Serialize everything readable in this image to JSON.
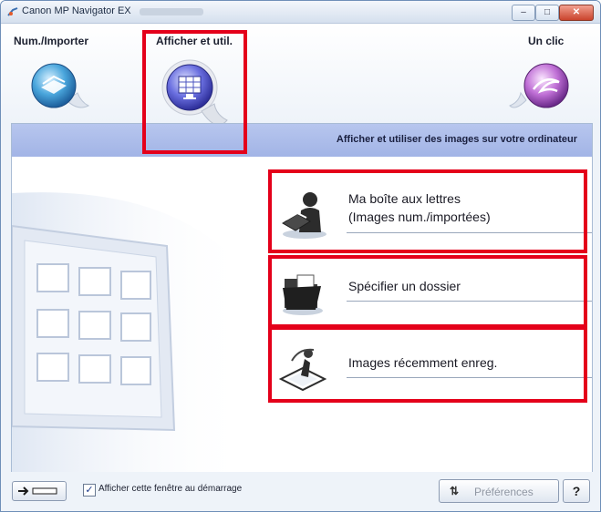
{
  "window": {
    "title": "Canon MP Navigator EX"
  },
  "modes": {
    "scan_import": {
      "label": "Num./Importer",
      "icon": "scanner-icon"
    },
    "view_use": {
      "label": "Afficher et util.",
      "icon": "monitor-grid-icon"
    },
    "one_click": {
      "label": "Un clic",
      "icon": "swirl-icon"
    }
  },
  "panel": {
    "header": "Afficher et utiliser des images sur votre ordinateur",
    "items": [
      {
        "label_line1": "Ma boîte aux lettres",
        "label_line2": "(Images num./importées)",
        "icon": "person-mailbox-icon"
      },
      {
        "label_line1": "Spécifier un dossier",
        "icon": "folder-icon"
      },
      {
        "label_line1": "Images récemment enreg.",
        "icon": "recent-images-icon"
      }
    ]
  },
  "footer": {
    "show_on_startup_label": "Afficher cette fenêtre au démarrage",
    "show_on_startup_checked": true,
    "preferences_label": "Préférences",
    "help_label": "?"
  },
  "colors": {
    "highlight_frame": "#e4001a",
    "header_bg": "#a8b8e8"
  }
}
